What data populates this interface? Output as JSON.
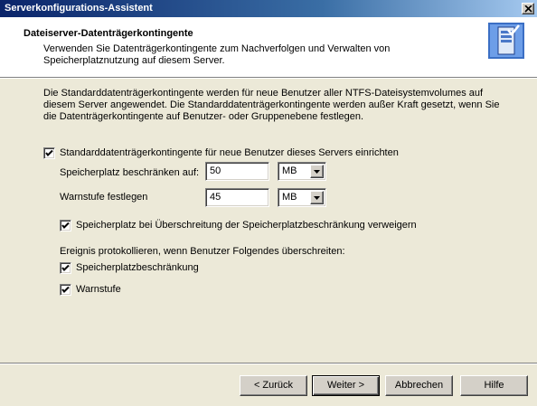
{
  "window": {
    "title": "Serverkonfigurations-Assistent"
  },
  "header": {
    "title": "Dateiserver-Datenträgerkontingente",
    "subtitle": "Verwenden Sie Datenträgerkontingente zum Nachverfolgen und Verwalten von Speicherplatznutzung auf diesem Server."
  },
  "intro": "Die Standarddatenträgerkontingente werden für neue Benutzer aller NTFS-Dateisystemvolumes auf diesem Server angewendet. Die Standarddatenträgerkontingente werden außer Kraft gesetzt, wenn Sie die Datenträgerkontingente auf Benutzer- oder Gruppenebene festlegen.",
  "form": {
    "enable_quota": {
      "label": "Standarddatenträgerkontingente für neue Benutzer dieses Servers einrichten",
      "checked": true
    },
    "limit": {
      "label": "Speicherplatz beschränken auf:",
      "value": "50",
      "unit": "MB"
    },
    "warning": {
      "label": "Warnstufe festlegen",
      "value": "45",
      "unit": "MB"
    },
    "deny": {
      "label": "Speicherplatz bei Überschreitung der Speicherplatzbeschränkung verweigern",
      "checked": true
    },
    "log_heading": "Ereignis protokollieren, wenn Benutzer Folgendes überschreiten:",
    "log_limit": {
      "label": "Speicherplatzbeschränkung",
      "checked": true
    },
    "log_warning": {
      "label": "Warnstufe",
      "checked": true
    }
  },
  "buttons": {
    "back": "< Zurück",
    "next": "Weiter >",
    "cancel": "Abbrechen",
    "help": "Hilfe"
  },
  "colors": {
    "titlebar": "#0a246a",
    "face": "#ece9d8"
  }
}
